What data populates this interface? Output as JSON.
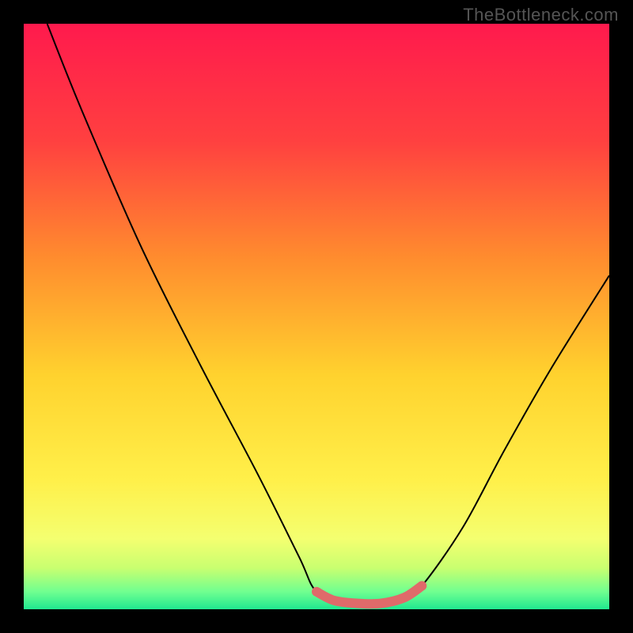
{
  "watermark": "TheBottleneck.com",
  "chart_data": {
    "type": "line",
    "title": "",
    "xlabel": "",
    "ylabel": "",
    "xlim": [
      0,
      100
    ],
    "ylim": [
      0,
      100
    ],
    "grid": false,
    "legend": false,
    "background": {
      "type": "vertical-gradient",
      "stops": [
        {
          "pos": 0.0,
          "color": "#ff1a4d"
        },
        {
          "pos": 0.2,
          "color": "#ff4040"
        },
        {
          "pos": 0.4,
          "color": "#ff8c2e"
        },
        {
          "pos": 0.6,
          "color": "#ffd22e"
        },
        {
          "pos": 0.78,
          "color": "#fff04a"
        },
        {
          "pos": 0.88,
          "color": "#f4ff70"
        },
        {
          "pos": 0.93,
          "color": "#c8ff70"
        },
        {
          "pos": 0.97,
          "color": "#70ff90"
        },
        {
          "pos": 1.0,
          "color": "#20e890"
        }
      ]
    },
    "series": [
      {
        "name": "bottleneck-curve",
        "stroke": "#000000",
        "stroke_width": 2,
        "points": [
          {
            "x": 4,
            "y": 100
          },
          {
            "x": 10,
            "y": 85
          },
          {
            "x": 20,
            "y": 62
          },
          {
            "x": 30,
            "y": 42
          },
          {
            "x": 40,
            "y": 23
          },
          {
            "x": 47,
            "y": 9
          },
          {
            "x": 50,
            "y": 3
          },
          {
            "x": 55,
            "y": 1
          },
          {
            "x": 60,
            "y": 1
          },
          {
            "x": 65,
            "y": 2
          },
          {
            "x": 68,
            "y": 4
          },
          {
            "x": 75,
            "y": 14
          },
          {
            "x": 82,
            "y": 27
          },
          {
            "x": 90,
            "y": 41
          },
          {
            "x": 100,
            "y": 57
          }
        ]
      },
      {
        "name": "optimal-range-marker",
        "stroke": "#e06a6a",
        "stroke_width": 12,
        "points": [
          {
            "x": 50,
            "y": 3
          },
          {
            "x": 53,
            "y": 1.5
          },
          {
            "x": 57,
            "y": 1
          },
          {
            "x": 61,
            "y": 1
          },
          {
            "x": 65,
            "y": 2
          },
          {
            "x": 68,
            "y": 4
          }
        ]
      }
    ],
    "markers": [
      {
        "x": 68,
        "y": 4,
        "r": 6,
        "color": "#e06a6a"
      }
    ]
  }
}
